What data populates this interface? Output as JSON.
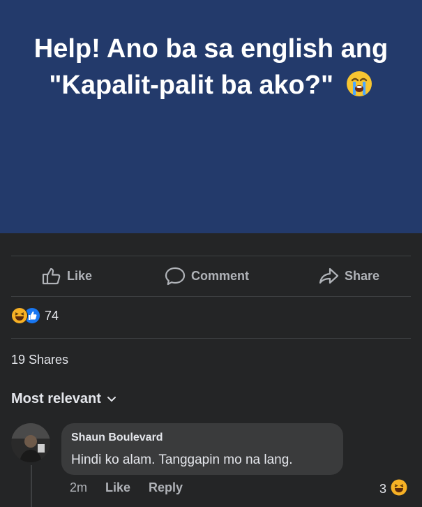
{
  "post": {
    "text": "Help! Ano ba sa english ang \"Kapalit-palit ba ako?\"",
    "emoji": "crying-face-icon",
    "background_color": "#233a6b"
  },
  "actions": {
    "like_label": "Like",
    "comment_label": "Comment",
    "share_label": "Share"
  },
  "reactions": {
    "icons": [
      "haha-reaction-icon",
      "like-reaction-icon"
    ],
    "count": "74"
  },
  "shares": {
    "text": "19 Shares"
  },
  "comments_sort": {
    "label": "Most relevant"
  },
  "comments": [
    {
      "author": "Shaun Boulevard",
      "text": "Hindi ko alam. Tanggapin mo na lang.",
      "time": "2m",
      "like_label": "Like",
      "reply_label": "Reply",
      "reaction_count": "3",
      "reaction_icon": "haha-reaction-icon"
    }
  ],
  "colors": {
    "page_background": "#242526",
    "text_primary": "#e4e6eb",
    "text_secondary": "#b0b3b8",
    "like_blue": "#1877f2",
    "haha_yellow": "#f7b125"
  }
}
